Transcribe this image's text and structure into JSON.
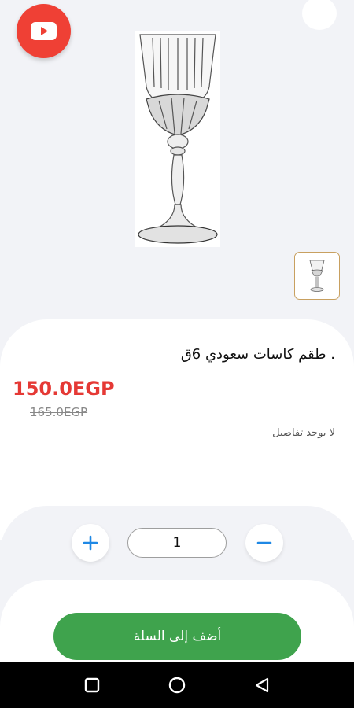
{
  "product": {
    "title": ". طقم كاسات سعودي 6ق",
    "price": "150.0EGP",
    "old_price": "165.0EGP",
    "details": "لا يوجد تفاصيل"
  },
  "quantity": {
    "value": "1"
  },
  "actions": {
    "add_to_cart_label": "أضف إلى السلة"
  },
  "icons": {
    "video": "youtube-play-icon",
    "increase": "plus-icon",
    "decrease": "minus-icon",
    "nav_recents": "square-icon",
    "nav_home": "circle-icon",
    "nav_back": "triangle-back-icon"
  },
  "colors": {
    "youtube": "#ef4035",
    "price": "#e53935",
    "accent_blue": "#1e88e5",
    "add_to_cart": "#3fa34d",
    "thumbnail_border": "#c8a060"
  }
}
